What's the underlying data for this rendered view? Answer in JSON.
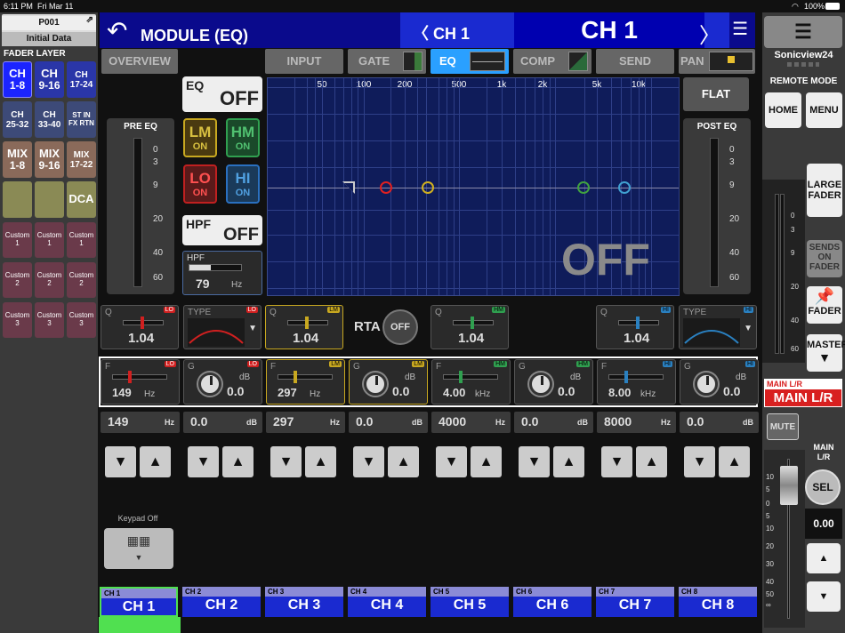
{
  "status": {
    "time": "6:11 PM",
    "date": "Fri Mar 11",
    "battery": "100%"
  },
  "project": {
    "name": "P001",
    "scene": "Initial Data"
  },
  "fader_layer": {
    "title": "FADER LAYER",
    "buttons": [
      {
        "t": "CH",
        "s": "1-8",
        "style": "blue sel"
      },
      {
        "t": "CH",
        "s": "9-16",
        "style": "blue"
      },
      {
        "t": "CH",
        "s": "17-24",
        "style": "blue small"
      },
      {
        "t": "CH",
        "s": "25-32",
        "style": "bluegray small"
      },
      {
        "t": "CH",
        "s": "33-40",
        "style": "bluegray small"
      },
      {
        "t": "ST IN",
        "s": "FX RTN",
        "style": "bluegray tiny"
      },
      {
        "t": "MIX",
        "s": "1-8",
        "style": "brown"
      },
      {
        "t": "MIX",
        "s": "9-16",
        "style": "brown"
      },
      {
        "t": "MIX",
        "s": "17-22",
        "style": "brown small"
      },
      {
        "t": "",
        "s": "",
        "style": "olive"
      },
      {
        "t": "",
        "s": "",
        "style": "olive"
      },
      {
        "t": "DCA",
        "s": "",
        "style": "olive"
      },
      {
        "t": "Custom",
        "s": "1",
        "style": "maroon"
      },
      {
        "t": "Custom",
        "s": "1",
        "style": "maroon"
      },
      {
        "t": "Custom",
        "s": "1",
        "style": "maroon"
      },
      {
        "t": "Custom",
        "s": "2",
        "style": "maroon"
      },
      {
        "t": "Custom",
        "s": "2",
        "style": "maroon"
      },
      {
        "t": "Custom",
        "s": "2",
        "style": "maroon"
      },
      {
        "t": "Custom",
        "s": "3",
        "style": "maroon"
      },
      {
        "t": "Custom",
        "s": "3",
        "style": "maroon"
      },
      {
        "t": "Custom",
        "s": "3",
        "style": "maroon"
      }
    ]
  },
  "header": {
    "title": "MODULE (EQ)",
    "channel_short": "CH 1",
    "channel_name": "CH 1"
  },
  "tabs": {
    "overview": "OVERVIEW",
    "input": "INPUT",
    "gate": "GATE",
    "eq": "EQ",
    "comp": "COMP",
    "send": "SEND",
    "pan": "PAN"
  },
  "eq": {
    "eq_label": "EQ",
    "eq_state": "OFF",
    "hpf_label": "HPF",
    "hpf_state": "OFF",
    "hpf_title": "HPF",
    "hpf_value": "79",
    "hpf_unit": "Hz",
    "flat": "FLAT",
    "graph_state": "OFF",
    "rta_label": "RTA",
    "rta_state": "OFF"
  },
  "bands": {
    "lm": {
      "n": "LM",
      "o": "ON"
    },
    "hm": {
      "n": "HM",
      "o": "ON"
    },
    "lo": {
      "n": "LO",
      "o": "ON"
    },
    "hi": {
      "n": "HI",
      "o": "ON"
    }
  },
  "pre_eq": {
    "title": "PRE EQ",
    "scale": [
      "0",
      "3",
      "9",
      "20",
      "40",
      "60"
    ]
  },
  "post_eq": {
    "title": "POST EQ",
    "scale": [
      "0",
      "3",
      "9",
      "20",
      "40",
      "60"
    ]
  },
  "graph": {
    "freqs": [
      "50",
      "100",
      "200",
      "500",
      "1k",
      "2k",
      "5k",
      "10k"
    ]
  },
  "q_row": [
    {
      "label": "Q",
      "tag": "LO",
      "value": "1.04"
    },
    {
      "label": "TYPE",
      "tag": "LO"
    },
    {
      "label": "Q",
      "tag": "LM",
      "value": "1.04"
    },
    {
      "label": "Q",
      "tag": "HM",
      "value": "1.04"
    },
    {
      "label": "Q",
      "tag": "HI",
      "value": "1.04"
    },
    {
      "label": "TYPE",
      "tag": "HI"
    }
  ],
  "fg_row": [
    {
      "label": "F",
      "tag": "LO",
      "value": "149",
      "unit": "Hz"
    },
    {
      "label": "G",
      "tag": "LO",
      "value": "0.0",
      "unit": "dB"
    },
    {
      "label": "F",
      "tag": "LM",
      "value": "297",
      "unit": "Hz"
    },
    {
      "label": "G",
      "tag": "LM",
      "value": "0.0",
      "unit": "dB"
    },
    {
      "label": "F",
      "tag": "HM",
      "value": "4.00",
      "unit": "kHz"
    },
    {
      "label": "G",
      "tag": "HM",
      "value": "0.0",
      "unit": "dB"
    },
    {
      "label": "F",
      "tag": "HI",
      "value": "8.00",
      "unit": "kHz"
    },
    {
      "label": "G",
      "tag": "HI",
      "value": "0.0",
      "unit": "dB"
    }
  ],
  "fields": [
    {
      "v": "149",
      "u": "Hz"
    },
    {
      "v": "0.0",
      "u": "dB"
    },
    {
      "v": "297",
      "u": "Hz"
    },
    {
      "v": "0.0",
      "u": "dB"
    },
    {
      "v": "4000",
      "u": "Hz"
    },
    {
      "v": "0.0",
      "u": "dB"
    },
    {
      "v": "8000",
      "u": "Hz"
    },
    {
      "v": "0.0",
      "u": "dB"
    }
  ],
  "keypad": {
    "label": "Keypad Off"
  },
  "channels": [
    {
      "top": "CH 1",
      "name": "CH 1"
    },
    {
      "top": "CH 2",
      "name": "CH 2"
    },
    {
      "top": "CH 3",
      "name": "CH 3"
    },
    {
      "top": "CH 4",
      "name": "CH 4"
    },
    {
      "top": "CH 5",
      "name": "CH 5"
    },
    {
      "top": "CH 6",
      "name": "CH 6"
    },
    {
      "top": "CH 7",
      "name": "CH 7"
    },
    {
      "top": "CH 8",
      "name": "CH 8"
    }
  ],
  "right": {
    "device": "Sonicview24",
    "remote_mode": "REMOTE MODE",
    "home": "HOME",
    "menu": "MENU",
    "large_fader_1": "LARGE",
    "large_fader_2": "FADER",
    "sends_1": "SENDS",
    "sends_2": "ON",
    "sends_3": "FADER",
    "fader": "FADER",
    "master": "MASTER",
    "main_lr_small": "MAIN L/R",
    "main_lr": "MAIN L/R",
    "mute": "MUTE",
    "main_lr_label_1": "MAIN",
    "main_lr_label_2": "L/R",
    "sel": "SEL",
    "level": "0.00",
    "meter_scale": [
      "0",
      "3",
      "9",
      "20",
      "40",
      "60"
    ],
    "fader_scale": [
      "10",
      "5",
      "0",
      "5",
      "10",
      "20",
      "30",
      "40",
      "50",
      "∞"
    ]
  }
}
